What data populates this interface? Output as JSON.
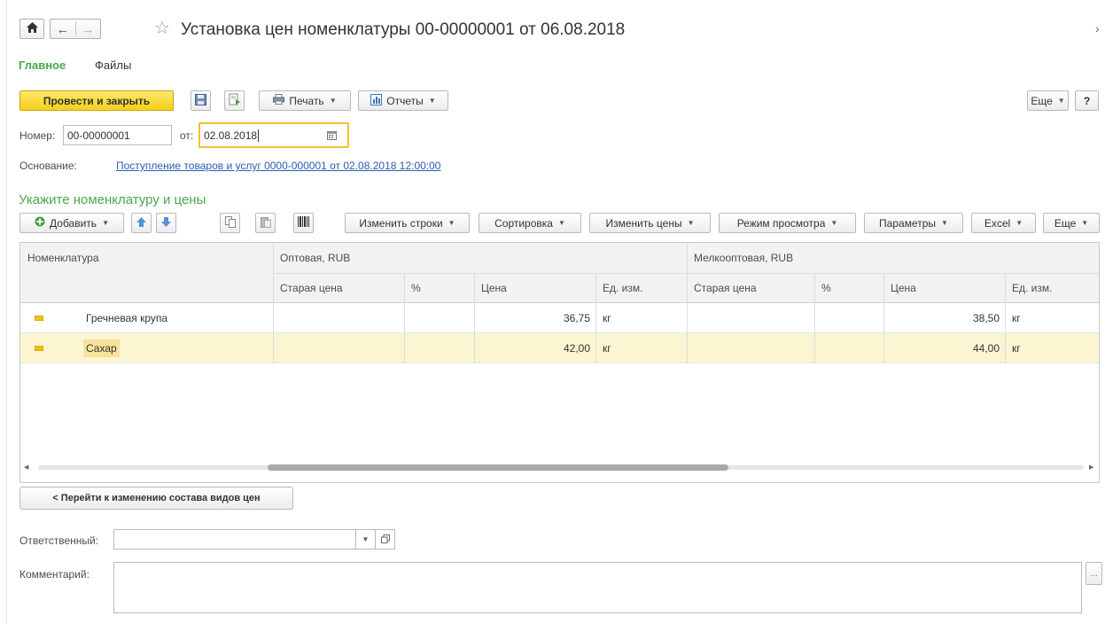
{
  "window": {
    "title": "Установка цен номенклатуры 00-00000001 от 06.08.2018",
    "nav_glyphs": {
      "home": "⌂",
      "back": "←",
      "forward": "→",
      "star": "☆",
      "more": "›"
    }
  },
  "tabs": [
    {
      "label": "Главное",
      "active": true
    },
    {
      "label": "Файлы",
      "active": false
    }
  ],
  "toolbar": {
    "post_close_label": "Провести и закрыть",
    "print_label": "Печать",
    "reports_label": "Отчеты",
    "more_label": "Еще",
    "help_label": "?"
  },
  "header": {
    "number_label": "Номер:",
    "number_value": "00-00000001",
    "date_label": "от:",
    "date_value": "02.08.2018",
    "basis_label": "Основание:",
    "basis_link": "Поступление товаров и услуг 0000-000001 от 02.08.2018 12:00:00"
  },
  "section": {
    "title": "Укажите номенклатуру и цены"
  },
  "table_toolbar": {
    "add_label": "Добавить",
    "change_rows_label": "Изменить строки",
    "sort_label": "Сортировка",
    "change_prices_label": "Изменить цены",
    "view_mode_label": "Режим просмотра",
    "params_label": "Параметры",
    "excel_label": "Excel",
    "more_label": "Еще"
  },
  "table": {
    "col_nomenclature": "Номенклатура",
    "group_wholesale": "Оптовая, RUB",
    "group_small_wholesale": "Мелкооптовая, RUB",
    "sub_old_price": "Старая цена",
    "sub_percent": "%",
    "sub_price": "Цена",
    "sub_unit": "Ед. изм.",
    "rows": [
      {
        "name": "Гречневая крупа",
        "w_old": "",
        "w_pct": "",
        "w_price": "36,75",
        "w_unit": "кг",
        "s_old": "",
        "s_pct": "",
        "s_price": "38,50",
        "s_unit": "кг",
        "selected": false
      },
      {
        "name": "Сахар",
        "w_old": "",
        "w_pct": "",
        "w_price": "42,00",
        "w_unit": "кг",
        "s_old": "",
        "s_pct": "",
        "s_price": "44,00",
        "s_unit": "кг",
        "selected": true
      }
    ]
  },
  "footer": {
    "back_button": "< Перейти к изменению состава видов цен",
    "responsible_label": "Ответственный:",
    "responsible_value": "",
    "comment_label": "Комментарий:",
    "comment_value": "",
    "ellipsis": "..."
  },
  "colors": {
    "accent_green": "#4aa84a",
    "link_blue": "#2a5db0",
    "primary_yellow": "#f5cf1b",
    "focus_border": "#f0c030",
    "selected_row": "#fbf5d2"
  }
}
